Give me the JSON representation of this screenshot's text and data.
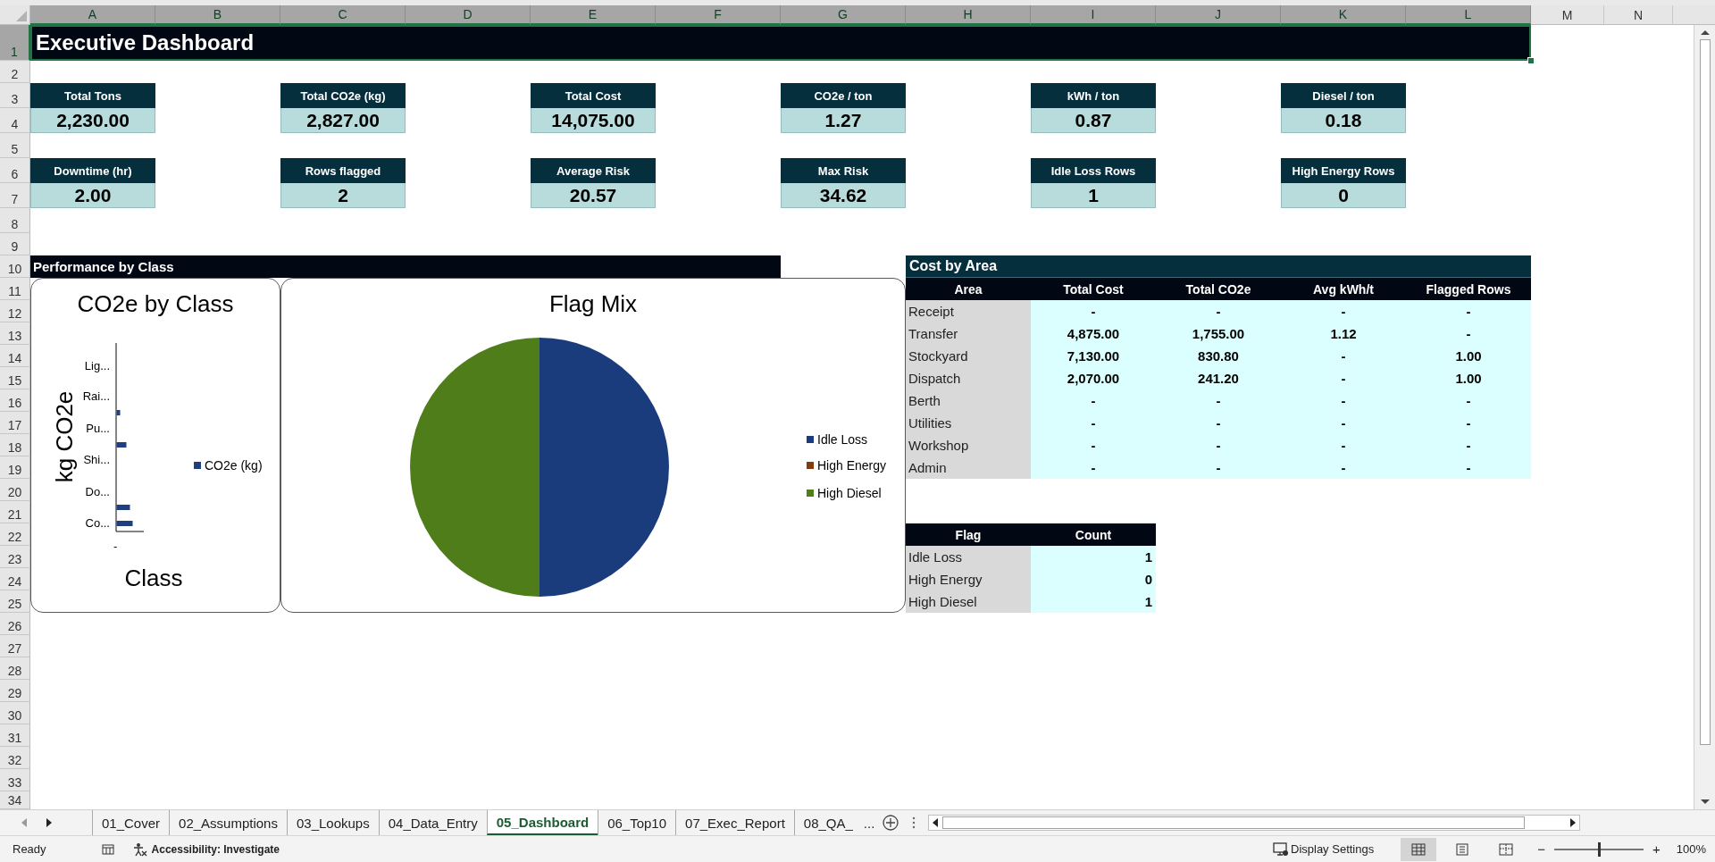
{
  "column_headers": [
    {
      "label": "A",
      "selected": true
    },
    {
      "label": "B",
      "selected": true
    },
    {
      "label": "C",
      "selected": true
    },
    {
      "label": "D",
      "selected": true
    },
    {
      "label": "E",
      "selected": true
    },
    {
      "label": "F",
      "selected": true
    },
    {
      "label": "G",
      "selected": true
    },
    {
      "label": "H",
      "selected": true
    },
    {
      "label": "I",
      "selected": true
    },
    {
      "label": "J",
      "selected": true
    },
    {
      "label": "K",
      "selected": true
    },
    {
      "label": "L",
      "selected": true
    },
    {
      "label": "M",
      "selected": false
    },
    {
      "label": "N",
      "selected": false
    }
  ],
  "row_headers": [
    {
      "label": "1",
      "selected": true
    },
    {
      "label": "2",
      "selected": false
    },
    {
      "label": "3",
      "selected": false
    },
    {
      "label": "4",
      "selected": false
    },
    {
      "label": "5",
      "selected": false
    },
    {
      "label": "6",
      "selected": false
    },
    {
      "label": "7",
      "selected": false
    },
    {
      "label": "8",
      "selected": false
    },
    {
      "label": "9",
      "selected": false
    },
    {
      "label": "10",
      "selected": false
    },
    {
      "label": "11",
      "selected": false
    },
    {
      "label": "12",
      "selected": false
    },
    {
      "label": "13",
      "selected": false
    },
    {
      "label": "14",
      "selected": false
    },
    {
      "label": "15",
      "selected": false
    },
    {
      "label": "16",
      "selected": false
    },
    {
      "label": "17",
      "selected": false
    },
    {
      "label": "18",
      "selected": false
    },
    {
      "label": "19",
      "selected": false
    },
    {
      "label": "20",
      "selected": false
    },
    {
      "label": "21",
      "selected": false
    },
    {
      "label": "22",
      "selected": false
    },
    {
      "label": "23",
      "selected": false
    },
    {
      "label": "24",
      "selected": false
    },
    {
      "label": "25",
      "selected": false
    },
    {
      "label": "26",
      "selected": false
    },
    {
      "label": "27",
      "selected": false
    },
    {
      "label": "28",
      "selected": false
    },
    {
      "label": "29",
      "selected": false
    },
    {
      "label": "30",
      "selected": false
    },
    {
      "label": "31",
      "selected": false
    },
    {
      "label": "32",
      "selected": false
    },
    {
      "label": "33",
      "selected": false
    },
    {
      "label": "34",
      "selected": false
    }
  ],
  "title": "Executive Dashboard",
  "kpis": [
    {
      "label": "Total Tons",
      "value": "2,230.00"
    },
    {
      "label": "Total CO2e (kg)",
      "value": "2,827.00"
    },
    {
      "label": "Total Cost",
      "value": "14,075.00"
    },
    {
      "label": "CO2e / ton",
      "value": "1.27"
    },
    {
      "label": "kWh / ton",
      "value": "0.87"
    },
    {
      "label": "Diesel / ton",
      "value": "0.18"
    },
    {
      "label": "Downtime (hr)",
      "value": "2.00"
    },
    {
      "label": "Rows flagged",
      "value": "2"
    },
    {
      "label": "Average Risk",
      "value": "20.57"
    },
    {
      "label": "Max Risk",
      "value": "34.62"
    },
    {
      "label": "Idle Loss Rows",
      "value": "1"
    },
    {
      "label": "High Energy Rows",
      "value": "0"
    }
  ],
  "performance": {
    "title": "Performance by Class",
    "co2e_chart": {
      "title": "CO2e by Class",
      "ylabel": "kg CO2e",
      "xlabel": "Class",
      "category_labels": [
        "Lig...",
        "Rai...",
        "Pu...",
        "Shi...",
        "Do...",
        "Co..."
      ],
      "tick": "-",
      "legend": [
        {
          "label": "CO2e (kg)",
          "color": "#1f3f7f"
        }
      ]
    },
    "flag_mix": {
      "chart_data": {
        "type": "pie",
        "title": "Flag Mix",
        "legend": "right",
        "categories": [
          "Idle Loss",
          "High Energy",
          "High Diesel"
        ],
        "values": [
          50,
          0,
          50
        ]
      },
      "slices": [
        {
          "color": "#1a3c7c"
        },
        {
          "color": "#843c0c"
        },
        {
          "color": "#4e7d1a"
        }
      ]
    }
  },
  "cost_by_area": {
    "title": "Cost by Area",
    "columns": [
      "Area",
      "Total Cost",
      "Total CO2e",
      "Avg kWh/t",
      "Flagged Rows"
    ],
    "rows": [
      {
        "cells": [
          "Receipt",
          "-",
          "-",
          "-",
          "-"
        ]
      },
      {
        "cells": [
          "Transfer",
          "4,875.00",
          "1,755.00",
          "1.12",
          "-"
        ]
      },
      {
        "cells": [
          "Stockyard",
          "7,130.00",
          "830.80",
          "-",
          "1.00"
        ]
      },
      {
        "cells": [
          "Dispatch",
          "2,070.00",
          "241.20",
          "-",
          "1.00"
        ]
      },
      {
        "cells": [
          "Berth",
          "-",
          "-",
          "-",
          "-"
        ]
      },
      {
        "cells": [
          "Utilities",
          "-",
          "-",
          "-",
          "-"
        ]
      },
      {
        "cells": [
          "Workshop",
          "-",
          "-",
          "-",
          "-"
        ]
      },
      {
        "cells": [
          "Admin",
          "-",
          "-",
          "-",
          "-"
        ]
      }
    ]
  },
  "flag_table": {
    "columns": [
      "Flag",
      "Count"
    ],
    "rows": [
      {
        "cells": [
          "Idle Loss",
          "1"
        ]
      },
      {
        "cells": [
          "High Energy",
          "0"
        ]
      },
      {
        "cells": [
          "High Diesel",
          "1"
        ]
      }
    ]
  },
  "sheet_tabs": {
    "tabs": [
      {
        "label": "01_Cover",
        "selected": false
      },
      {
        "label": "02_Assumptions",
        "selected": false
      },
      {
        "label": "03_Lookups",
        "selected": false
      },
      {
        "label": "04_Data_Entry",
        "selected": false
      },
      {
        "label": "05_Dashboard",
        "selected": true
      },
      {
        "label": "06_Top10",
        "selected": false
      },
      {
        "label": "07_Exec_Report",
        "selected": false
      },
      {
        "label": "08_QA_",
        "selected": false
      }
    ],
    "overflow": "..."
  },
  "status_bar": {
    "ready": "Ready",
    "accessibility": "Accessibility: Investigate",
    "display_settings": "Display Settings",
    "views": [
      {
        "kind": "normal",
        "selected": true
      },
      {
        "kind": "page_layout",
        "selected": false
      },
      {
        "kind": "page_break",
        "selected": false
      }
    ],
    "zoom": {
      "minus": "−",
      "plus": "+",
      "level": 0.5,
      "percent": "100%"
    }
  }
}
